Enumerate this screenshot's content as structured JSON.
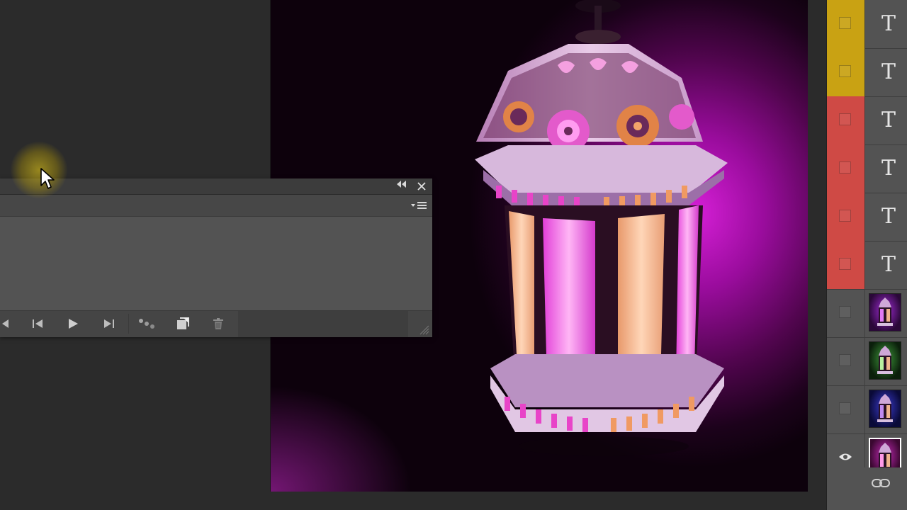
{
  "canvas": {
    "image_subject": "ramadan-lantern",
    "background_colors": [
      "#d51fd6",
      "#52054f",
      "#0d010c"
    ]
  },
  "panel": {
    "collapse_icon": "double-chevron-left-icon",
    "close_icon": "close-icon",
    "menu_icon": "panel-menu-icon",
    "footer_tools": [
      {
        "name": "prev-frame-icon"
      },
      {
        "name": "step-back-icon"
      },
      {
        "name": "play-icon"
      },
      {
        "name": "step-forward-icon"
      },
      {
        "name": "tween-icon"
      },
      {
        "name": "duplicate-frame-icon"
      },
      {
        "name": "delete-frame-icon"
      }
    ]
  },
  "layers": {
    "rows": [
      {
        "type": "text",
        "glyph": "T",
        "color": "#c9a213",
        "visible": false
      },
      {
        "type": "text",
        "glyph": "T",
        "color": "#c9a213",
        "visible": false
      },
      {
        "type": "text",
        "glyph": "T",
        "color": "#cf4a45",
        "visible": false
      },
      {
        "type": "text",
        "glyph": "T",
        "color": "#cf4a45",
        "visible": false
      },
      {
        "type": "text",
        "glyph": "T",
        "color": "#cf4a45",
        "visible": false
      },
      {
        "type": "text",
        "glyph": "T",
        "color": "#cf4a45",
        "visible": false
      },
      {
        "type": "image",
        "thumb": "purple-lantern",
        "visible": false
      },
      {
        "type": "image",
        "thumb": "green-lantern",
        "visible": false
      },
      {
        "type": "image",
        "thumb": "blue-lantern",
        "visible": false
      },
      {
        "type": "image",
        "thumb": "pink-lantern",
        "visible": true,
        "selected": true
      }
    ],
    "footer_icon": "link-layers-icon"
  }
}
